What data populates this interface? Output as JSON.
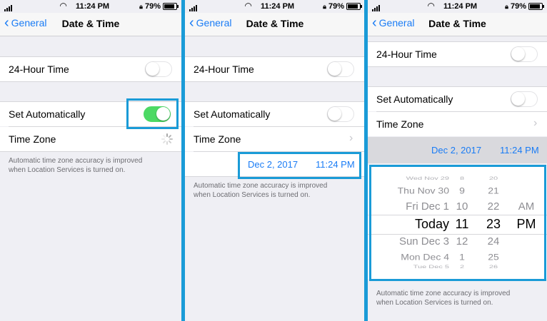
{
  "status": {
    "time": "11:24 PM",
    "battery": "79%"
  },
  "nav": {
    "back": "General",
    "title": "Date & Time"
  },
  "rows": {
    "hour24": "24-Hour Time",
    "set_auto": "Set Automatically",
    "time_zone": "Time Zone"
  },
  "footer": {
    "line1": "Automatic time zone accuracy is improved",
    "line2": "when Location Services is turned on."
  },
  "toggles": {
    "panel1": {
      "hour24": false,
      "set_auto": true
    },
    "panel2": {
      "hour24": false,
      "set_auto": false
    },
    "panel3": {
      "hour24": false,
      "set_auto": false
    }
  },
  "date": "Dec 2, 2017",
  "time": "11:24 PM",
  "picker": {
    "dates": [
      "Wed Nov 29",
      "Thu Nov 30",
      "Fri Dec 1",
      "Today",
      "Sun Dec 3",
      "Mon Dec 4",
      "Tue Dec 5"
    ],
    "hours": [
      "8",
      "9",
      "10",
      "11",
      "12",
      "1",
      "2"
    ],
    "minutes": [
      "20",
      "21",
      "22",
      "23",
      "24",
      "25",
      "26"
    ],
    "ampm": [
      "AM",
      "PM"
    ]
  },
  "colors": {
    "accent": "#1a7cf5",
    "highlight": "#1a9bd7",
    "toggle_on": "#4cd964"
  }
}
